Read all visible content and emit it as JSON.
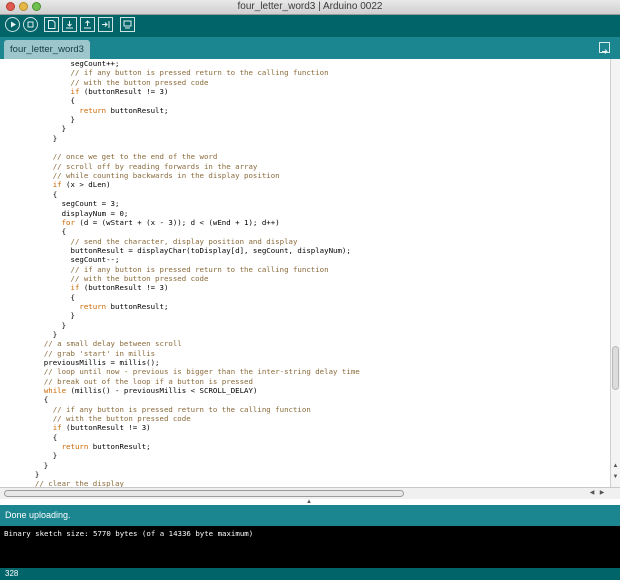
{
  "window": {
    "title": "four_letter_word3 | Arduino 0022"
  },
  "toolbar": {
    "buttons": [
      {
        "name": "verify",
        "icon": "play-icon"
      },
      {
        "name": "stop",
        "icon": "stop-icon"
      },
      {
        "name": "new",
        "icon": "new-file-icon"
      },
      {
        "name": "open",
        "icon": "open-icon"
      },
      {
        "name": "save",
        "icon": "save-icon"
      },
      {
        "name": "upload",
        "icon": "upload-icon"
      },
      {
        "name": "serial-monitor",
        "icon": "serial-monitor-icon"
      }
    ]
  },
  "tabs": [
    {
      "label": "four_letter_word3",
      "active": true
    }
  ],
  "editor": {
    "lines": [
      "          segCount++;",
      "          // if any button is pressed return to the calling function",
      "          // with the button pressed code",
      "          if (buttonResult != 3)",
      "          {",
      "            return buttonResult;",
      "          }",
      "        }",
      "      }",
      "",
      "      // once we get to the end of the word",
      "      // scroll off by reading forwards in the array",
      "      // while counting backwards in the display position",
      "      if (x > dLen)",
      "      {",
      "        segCount = 3;",
      "        displayNum = 0;",
      "        for (d = (wStart + (x - 3)); d < (wEnd + 1); d++)",
      "        {",
      "          // send the character, display position and display",
      "          buttonResult = displayChar(toDisplay[d], segCount, displayNum);",
      "          segCount--;",
      "          // if any button is pressed return to the calling function",
      "          // with the button pressed code",
      "          if (buttonResult != 3)",
      "          {",
      "            return buttonResult;",
      "          }",
      "        }",
      "      }",
      "    // a small delay between scroll",
      "    // grab 'start' in millis",
      "    previousMillis = millis();",
      "    // loop until now - previous is bigger than the inter-string delay time",
      "    // break out of the loop if a button is pressed",
      "    while (millis() - previousMillis < SCROLL_DELAY)",
      "    {",
      "      // if any button is pressed return to the calling function",
      "      // with the button pressed code",
      "      if (buttonResult != 3)",
      "      {",
      "        return buttonResult;",
      "      }",
      "    }",
      "  }",
      "  // clear the display"
    ]
  },
  "status": {
    "message": "Done uploading."
  },
  "console": {
    "output": "Binary sketch size: 5770 bytes (of a 14336 byte maximum)"
  },
  "footer": {
    "line_number": "328"
  },
  "colors": {
    "toolbar_bg": "#006468",
    "tabbar_bg": "#1b8590",
    "tab_bg": "#9cc6cc",
    "comment": "#8a6a3a",
    "keyword": "#cc6600",
    "console_bg": "#000000"
  }
}
